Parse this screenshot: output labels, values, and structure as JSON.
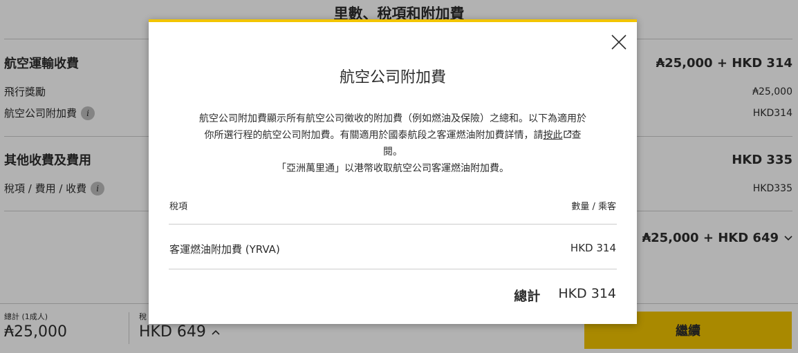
{
  "background": {
    "page_title": "里數、稅項和附加費",
    "airline_section": {
      "title": "航空運輸收費",
      "amount": "₳25,000 + HKD 314",
      "items": [
        {
          "label": "飛行獎勵",
          "amount": "₳25,000"
        },
        {
          "label": "航空公司附加費",
          "amount": "HKD314"
        }
      ]
    },
    "other_section": {
      "title": "其他收費及費用",
      "amount": "HKD 335",
      "items": [
        {
          "label": "稅項 / 費用 / 收費",
          "amount": "HKD335"
        }
      ]
    },
    "grand_total": "₳25,000 + HKD 649",
    "info_icon": "i"
  },
  "bottom_bar": {
    "total_label": "總計 (1成人)",
    "total_miles": "₳25,000",
    "tax_label": "稅",
    "tax_amount": "HKD 649",
    "continue_label": "繼續"
  },
  "modal": {
    "title": "航空公司附加費",
    "description_line1": "航空公司附加費顯示所有航空公司徵收的附加費（例如燃油及保險）之總和。以下為適用於",
    "description_line2_before": "你所選行程的航空公司附加費。有關適用於國泰航段之客運燃油附加費詳情，請",
    "description_link": "按此",
    "description_line2_after": "查",
    "description_line3": "閱。",
    "description_line4": "「亞洲萬里通」以港幣收取航空公司客運燃油附加費。",
    "table": {
      "col_item": "稅項",
      "col_amount": "數量 / 乘客",
      "rows": [
        {
          "name": "客運燃油附加費 (YRVA)",
          "amount": "HKD 314"
        }
      ],
      "total_label": "總計",
      "total_amount": "HKD 314"
    }
  },
  "colors": {
    "accent_yellow": "#f2c400",
    "overlay": "rgba(0,0,0,0.3)"
  }
}
